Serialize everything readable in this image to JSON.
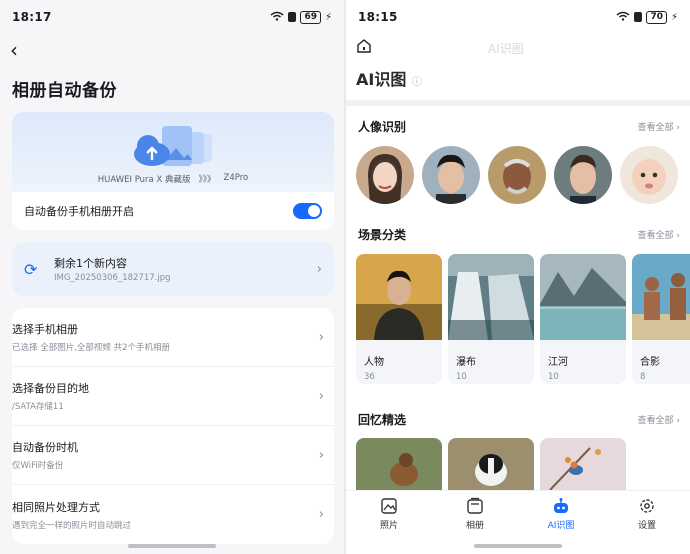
{
  "left": {
    "status": {
      "time": "18:17",
      "battery": "69"
    },
    "page_title": "相册自动备份",
    "hero": {
      "source_device": "HUAWEI Pura X 典藏版",
      "arrows": "》》》",
      "target_device": "Z4Pro",
      "toggle_label": "自动备份手机相册开启",
      "toggle_on": true
    },
    "sync": {
      "title": "剩余1个新内容",
      "file": "IMG_20250306_182717.jpg"
    },
    "settings": [
      {
        "title": "选择手机相册",
        "sub": "已选择 全部图片,全部视频 共2个手机相册"
      },
      {
        "title": "选择备份目的地",
        "sub": "/SATA存储11"
      },
      {
        "title": "自动备份时机",
        "sub": "仅WiFi时备份"
      },
      {
        "title": "相同照片处理方式",
        "sub": "遇到完全一样的照片时自动跳过"
      }
    ]
  },
  "right": {
    "status": {
      "time": "18:15",
      "battery": "70"
    },
    "faded_title": "AI识图",
    "title": "AI识图",
    "help_icon": "?",
    "sections": {
      "people": {
        "title": "人像识别",
        "see_all": "查看全部 ›"
      },
      "scenes": {
        "title": "场景分类",
        "see_all": "查看全部 ›"
      },
      "memories": {
        "title": "回忆精选",
        "see_all": "查看全部 ›"
      }
    },
    "scene_items": [
      {
        "label": "人物",
        "count": "36"
      },
      {
        "label": "瀑布",
        "count": "10"
      },
      {
        "label": "江河",
        "count": "10"
      },
      {
        "label": "合影",
        "count": "8"
      }
    ],
    "tabs": [
      {
        "label": "照片",
        "icon": "photo-icon"
      },
      {
        "label": "相册",
        "icon": "album-icon"
      },
      {
        "label": "AI识图",
        "icon": "robot-icon"
      },
      {
        "label": "设置",
        "icon": "settings-icon"
      }
    ],
    "active_tab": "AI识图",
    "accent": "#1769ff"
  }
}
